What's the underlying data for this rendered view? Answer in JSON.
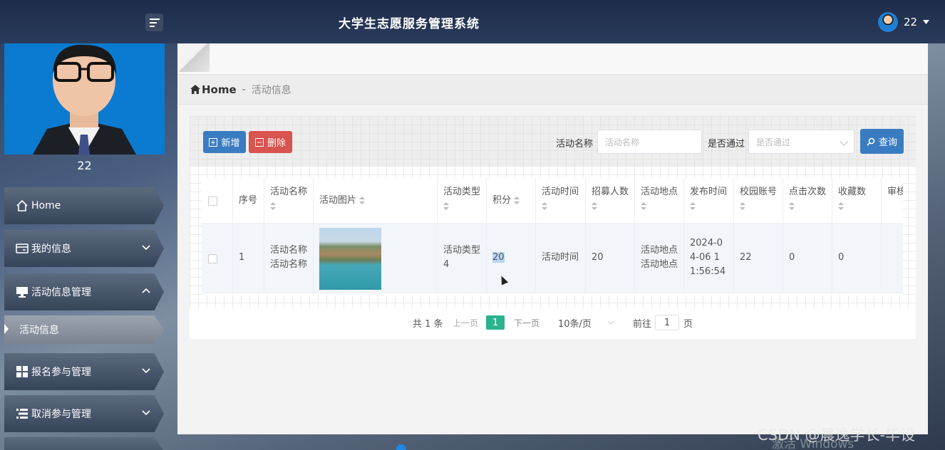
{
  "header": {
    "title": "大学生志愿服务管理系统",
    "user": "22"
  },
  "sidebar": {
    "username": "22",
    "items": [
      {
        "label": "Home",
        "icon": "home-icon"
      },
      {
        "label": "我的信息",
        "icon": "id-card-icon"
      },
      {
        "label": "活动信息管理",
        "icon": "monitor-icon",
        "sub": "活动信息"
      },
      {
        "label": "报名参与管理",
        "icon": "grid-icon"
      },
      {
        "label": "取消参与管理",
        "icon": "list-icon"
      }
    ]
  },
  "breadcrumb": {
    "home": "Home",
    "sep": "-",
    "current": "活动信息"
  },
  "toolbar": {
    "add": "新增",
    "delete": "删除",
    "query": "查询"
  },
  "search": {
    "name_label": "活动名称",
    "name_placeholder": "活动名称",
    "pass_label": "是否通过",
    "pass_placeholder": "是否通过"
  },
  "table": {
    "headers": [
      "序号",
      "活动名称",
      "活动图片",
      "活动类型",
      "积分",
      "活动时间",
      "招募人数",
      "活动地点",
      "发布时间",
      "校园账号",
      "点击次数",
      "收藏数",
      "审核"
    ],
    "row": {
      "index": "1",
      "name": "活动名称活动名称",
      "type": "活动类型4",
      "points": "20",
      "time": "活动时间",
      "recruit": "20",
      "place": "活动地点活动地点",
      "publish": "2024-04-06 11:56:54",
      "account": "22",
      "clicks": "0",
      "favorites": "0"
    }
  },
  "pager": {
    "total": "共 1 条",
    "prev": "上一页",
    "page": "1",
    "next": "下一页",
    "size": "10条/页",
    "goto": "前往",
    "goto_value": "1",
    "page_unit": "页"
  },
  "watermark": {
    "csdn": "CSDN @晨逸学长-毕设",
    "activate": "激活 Windows"
  }
}
